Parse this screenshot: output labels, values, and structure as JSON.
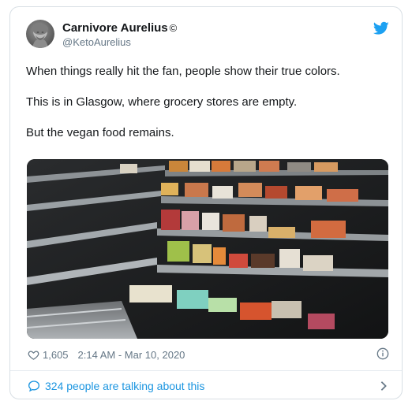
{
  "author": {
    "display_name": "Carnivore Aurelius",
    "verified_symbol": "©",
    "handle": "@KetoAurelius"
  },
  "tweet": {
    "paragraphs": [
      "When things really hit the fan, people show their true colors.",
      "This is in Glasgow, where grocery stores are empty.",
      "But the vegan food remains."
    ]
  },
  "meta": {
    "likes": "1,605",
    "timestamp": "2:14 AM - Mar 10, 2020"
  },
  "footer": {
    "talking_text": "324 people are talking about this"
  },
  "icons": {
    "bird": "twitter-bird-icon",
    "heart": "heart-icon",
    "info": "info-icon",
    "bubble": "speech-bubble-icon",
    "chevron": "chevron-right-icon"
  },
  "colors": {
    "accent": "#1da1f2",
    "link": "#1b95e0",
    "muted": "#657786",
    "text": "#14171a",
    "border": "#d8dfe4"
  }
}
